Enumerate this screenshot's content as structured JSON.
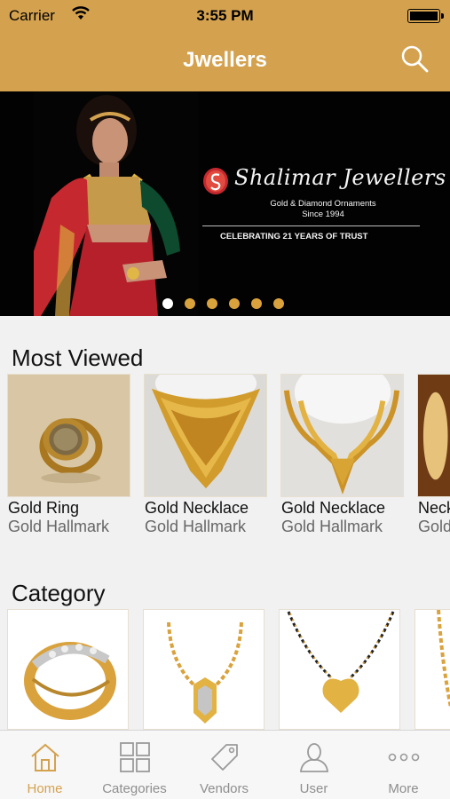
{
  "status_bar": {
    "carrier": "Carrier",
    "time": "3:55 PM"
  },
  "header": {
    "title": "Jwellers",
    "search_icon": "search-icon"
  },
  "banner": {
    "brand_name": "Shalimar Jewellers",
    "brand_line1": "Gold & Diamond Ornaments",
    "brand_line2": "Since 1994",
    "tagline": "CELEBRATING 21 YEARS OF TRUST",
    "slide_count": 6,
    "active_slide": 1
  },
  "most_viewed": {
    "title": "Most Viewed",
    "items": [
      {
        "name": "Gold Ring",
        "subtitle": "Gold Hallmark"
      },
      {
        "name": "Gold Necklace",
        "subtitle": "Gold Hallmark"
      },
      {
        "name": "Gold Necklace",
        "subtitle": "Gold Hallmark"
      },
      {
        "name": "Necklace",
        "subtitle": "Gold Hallmark"
      }
    ]
  },
  "category": {
    "title": "Category"
  },
  "tabs": [
    {
      "label": "Home",
      "icon": "home-icon",
      "active": true
    },
    {
      "label": "Categories",
      "icon": "grid-icon",
      "active": false
    },
    {
      "label": "Vendors",
      "icon": "tag-icon",
      "active": false
    },
    {
      "label": "User",
      "icon": "user-icon",
      "active": false
    },
    {
      "label": "More",
      "icon": "more-icon",
      "active": false
    }
  ],
  "colors": {
    "accent": "#d4a24f",
    "gold": "#d9a23d",
    "tab_inactive": "#8e8e8e"
  }
}
